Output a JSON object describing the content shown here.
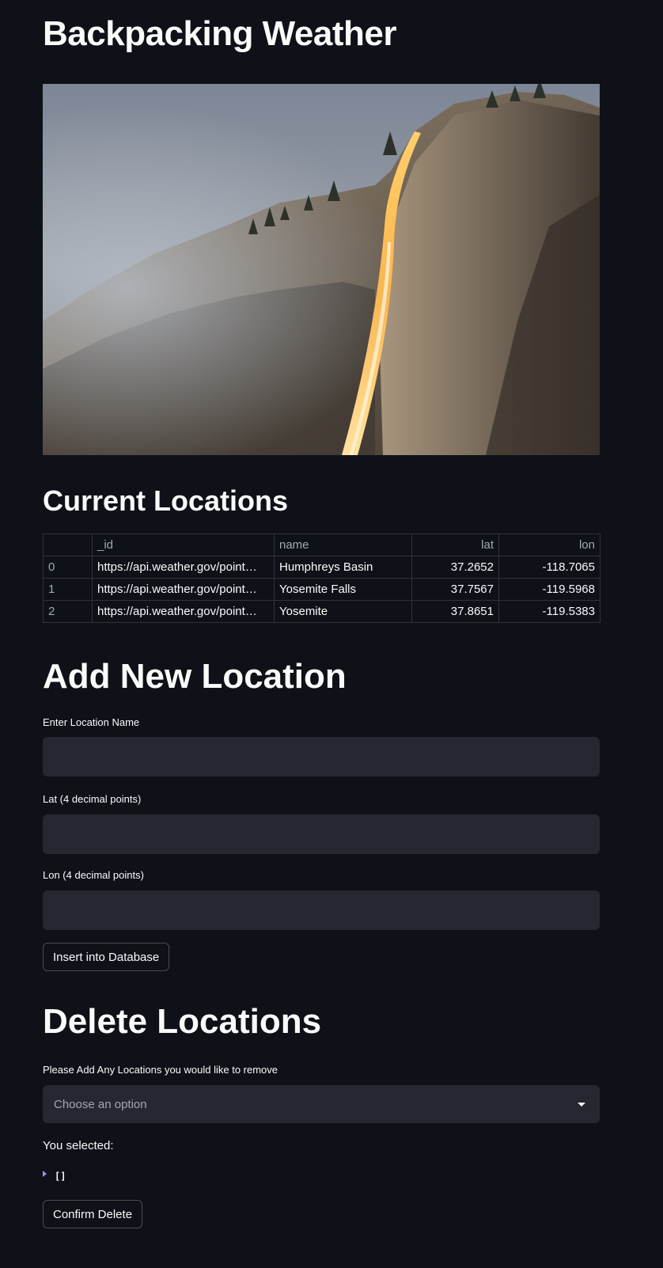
{
  "page": {
    "title": "Backpacking Weather"
  },
  "hero": {
    "image_icon": "waterfall-photo"
  },
  "current_locations": {
    "heading": "Current Locations",
    "columns": [
      "",
      "_id",
      "name",
      "lat",
      "lon"
    ],
    "rows": [
      {
        "index": "0",
        "id": "https://api.weather.gov/point…",
        "name": "Humphreys Basin",
        "lat": "37.2652",
        "lon": "-118.7065"
      },
      {
        "index": "1",
        "id": "https://api.weather.gov/point…",
        "name": "Yosemite Falls",
        "lat": "37.7567",
        "lon": "-119.5968"
      },
      {
        "index": "2",
        "id": "https://api.weather.gov/point…",
        "name": "Yosemite",
        "lat": "37.8651",
        "lon": "-119.5383"
      }
    ]
  },
  "add_location": {
    "heading": "Add New Location",
    "name_label": "Enter Location Name",
    "name_value": "",
    "lat_label": "Lat (4 decimal points)",
    "lat_value": "",
    "lon_label": "Lon (4 decimal points)",
    "lon_value": "",
    "insert_button": "Insert into Database"
  },
  "delete_locations": {
    "heading": "Delete Locations",
    "select_label": "Please Add Any Locations you would like to remove",
    "select_placeholder": "Choose an option",
    "selected_label": "You selected:",
    "selected_value": "[]",
    "confirm_button": "Confirm Delete"
  },
  "colors": {
    "background": "#0e1117",
    "input_bg": "#262730",
    "border": "#31333c",
    "accent": "#a78bfa"
  }
}
